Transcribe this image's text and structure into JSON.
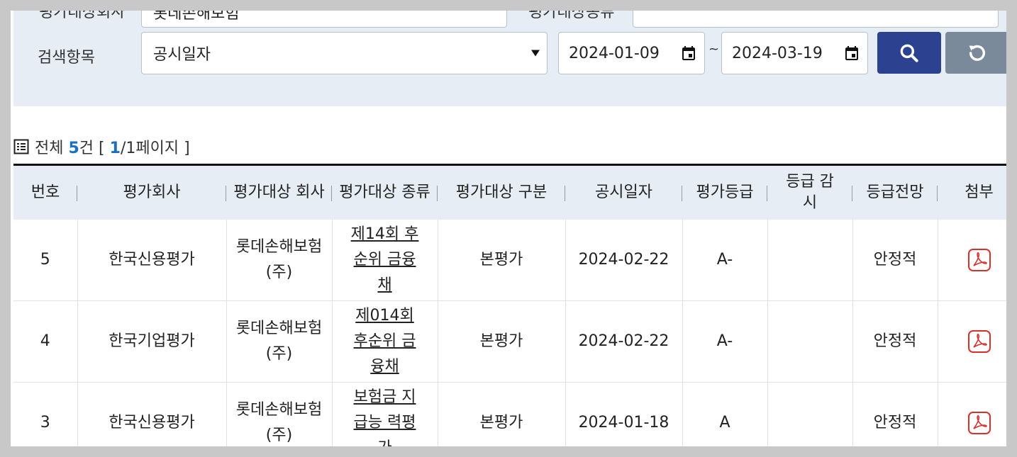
{
  "search": {
    "company_label": "평가대상회사",
    "company_value": "롯데손해보험",
    "type_label": "평가대상종류",
    "type_value": "",
    "field_label": "검색항목",
    "field_selected": "공시일자",
    "date_from": "2024-01-09",
    "date_to": "2024-03-19",
    "tilde": "~"
  },
  "summary": {
    "prefix": "전체",
    "count": "5",
    "count_unit": "건",
    "page_open": "[",
    "current_page": "1",
    "page_rest": "/1페이지",
    "page_close": "]"
  },
  "table": {
    "headers": [
      "번호",
      "평가회사",
      "평가대상 회사",
      "평가대상 종류",
      "평가대상 구분",
      "공시일자",
      "평가등급",
      "등급 감시",
      "등급전망",
      "첨부"
    ],
    "rows": [
      {
        "no": "5",
        "agency": "한국신용평가",
        "company": "롯데손해보험 (주)",
        "kind": "제14회 후순위 금융채",
        "category": "본평가",
        "date": "2024-02-22",
        "grade": "A-",
        "watch": "",
        "outlook": "안정적"
      },
      {
        "no": "4",
        "agency": "한국기업평가",
        "company": "롯데손해보험 (주)",
        "kind": "제014회 후순위 금융채",
        "category": "본평가",
        "date": "2024-02-22",
        "grade": "A-",
        "watch": "",
        "outlook": "안정적"
      },
      {
        "no": "3",
        "agency": "한국신용평가",
        "company": "롯데손해보험 (주)",
        "kind": "보험금 지급능 력평가",
        "category": "본평가",
        "date": "2024-01-18",
        "grade": "A",
        "watch": "",
        "outlook": "안정적"
      }
    ]
  },
  "icons": {
    "list": "list-icon",
    "calendar": "calendar-icon",
    "search": "search-icon",
    "reset": "refresh-icon",
    "attachment": "pdf-icon"
  },
  "colors": {
    "search_button": "#2c4190",
    "reset_button": "#7a8a9a",
    "panel": "#e6edf5",
    "accent": "#1a6fc4",
    "pdf": "#d9302c"
  }
}
